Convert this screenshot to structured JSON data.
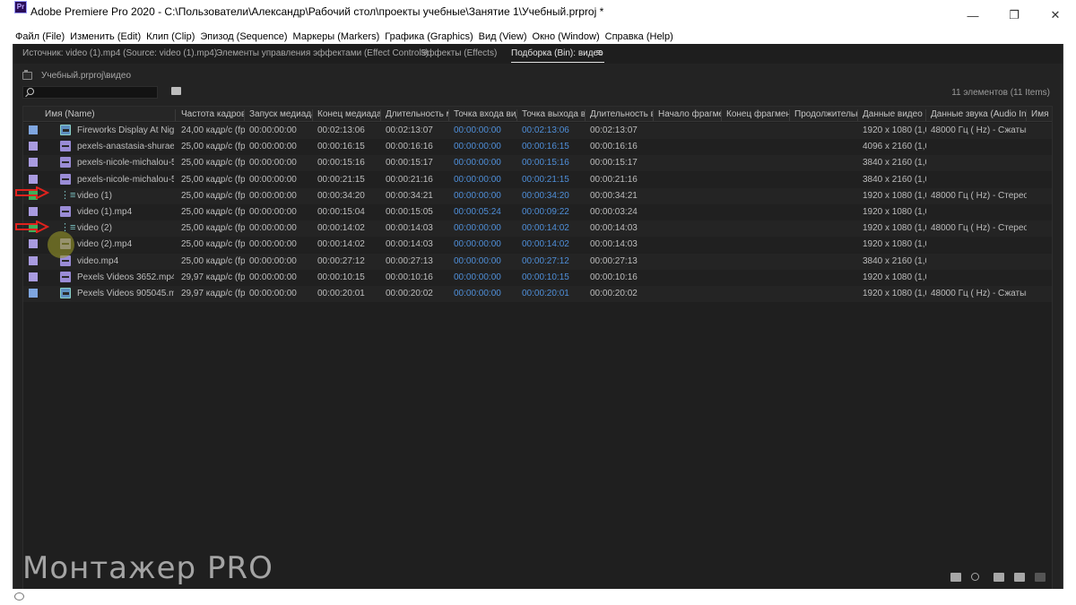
{
  "window": {
    "app_icon": "Pr",
    "title": "Adobe Premiere Pro 2020 - C:\\Пользователи\\Александр\\Рабочий стол\\проекты учебные\\Занятие 1\\Учебный.prproj *",
    "minimize": "—",
    "restore": "❐",
    "close": "✕"
  },
  "menu": [
    "Файл (File)",
    "Изменить (Edit)",
    "Клип (Clip)",
    "Эпизод (Sequence)",
    "Маркеры (Markers)",
    "Графика (Graphics)",
    "Вид (View)",
    "Окно (Window)",
    "Справка (Help)"
  ],
  "panel_tabs": [
    {
      "label": "Источник: video (1).mp4 (Source: video (1).mp4)"
    },
    {
      "label": "Элементы управления эффектами (Effect Controls)"
    },
    {
      "label": "Эффекты (Effects)"
    },
    {
      "label": "Подборка (Bin): видео"
    }
  ],
  "panel_menu_icon": "≡",
  "bin": {
    "path": "Учебный.prproj\\видео",
    "search_placeholder": "",
    "item_count": "11 элементов (11 Items)"
  },
  "columns": [
    "Имя (Name)",
    "Частота кадров (F",
    "Запуск медиадан",
    "Конец медиаданн",
    "Длительность ме",
    "Точка входа виде",
    "Точка выхода вид",
    "Длительность ви",
    "Начало фрагмент",
    "Конец фрагмента",
    "Продолжительнос",
    "Данные видео (Vi",
    "Данные звука (Audio Info)",
    "Имя"
  ],
  "rows": [
    {
      "name": "Fireworks Display At Night.",
      "type": "av",
      "color": "#7fa6e0",
      "fps": "24,00 кадр/с (fps)",
      "start": "00:00:00:00",
      "end": "00:02:13:06",
      "dur": "00:02:13:07",
      "in": "00:00:00:00",
      "out": "00:02:13:06",
      "vdur": "00:02:13:07",
      "video": "1920 x 1080 (1,0)",
      "audio": "48000 Гц ( Hz) - Сжатый (С"
    },
    {
      "name": "pexels-anastasia-shuraeva-",
      "type": "vid",
      "color": "#a99be0",
      "fps": "25,00 кадр/с (fps)",
      "start": "00:00:00:00",
      "end": "00:00:16:15",
      "dur": "00:00:16:16",
      "in": "00:00:00:00",
      "out": "00:00:16:15",
      "vdur": "00:00:16:16",
      "video": "4096 x 2160 (1,0)",
      "audio": ""
    },
    {
      "name": "pexels-nicole-michalou-573",
      "type": "vid",
      "color": "#a99be0",
      "fps": "25,00 кадр/с (fps)",
      "start": "00:00:00:00",
      "end": "00:00:15:16",
      "dur": "00:00:15:17",
      "in": "00:00:00:00",
      "out": "00:00:15:16",
      "vdur": "00:00:15:17",
      "video": "3840 x 2160 (1,0)",
      "audio": ""
    },
    {
      "name": "pexels-nicole-michalou-573",
      "type": "vid",
      "color": "#a99be0",
      "fps": "25,00 кадр/с (fps)",
      "start": "00:00:00:00",
      "end": "00:00:21:15",
      "dur": "00:00:21:16",
      "in": "00:00:00:00",
      "out": "00:00:21:15",
      "vdur": "00:00:21:16",
      "video": "3840 x 2160 (1,0)",
      "audio": ""
    },
    {
      "name": "video (1)",
      "type": "seq",
      "color": "#3fae59",
      "fps": "25,00 кадр/с (fps)",
      "start": "00:00:00:00",
      "end": "00:00:34:20",
      "dur": "00:00:34:21",
      "in": "00:00:00:00",
      "out": "00:00:34:20",
      "vdur": "00:00:34:21",
      "video": "1920 x 1080 (1,0)",
      "audio": "48000 Гц ( Hz) - Стерео (St"
    },
    {
      "name": "video (1).mp4",
      "type": "vid",
      "color": "#a99be0",
      "fps": "25,00 кадр/с (fps)",
      "start": "00:00:00:00",
      "end": "00:00:15:04",
      "dur": "00:00:15:05",
      "in": "00:00:05:24",
      "out": "00:00:09:22",
      "vdur": "00:00:03:24",
      "video": "1920 x 1080 (1,0)",
      "audio": ""
    },
    {
      "name": "video (2)",
      "type": "seq",
      "color": "#3fae59",
      "fps": "25,00 кадр/с (fps)",
      "start": "00:00:00:00",
      "end": "00:00:14:02",
      "dur": "00:00:14:03",
      "in": "00:00:00:00",
      "out": "00:00:14:02",
      "vdur": "00:00:14:03",
      "video": "1920 x 1080 (1,0)",
      "audio": "48000 Гц ( Hz) - Стерео (St"
    },
    {
      "name": "video (2).mp4",
      "type": "vid",
      "color": "#a99be0",
      "fps": "25,00 кадр/с (fps)",
      "start": "00:00:00:00",
      "end": "00:00:14:02",
      "dur": "00:00:14:03",
      "in": "00:00:00:00",
      "out": "00:00:14:02",
      "vdur": "00:00:14:03",
      "video": "1920 x 1080 (1,0)",
      "audio": ""
    },
    {
      "name": "video.mp4",
      "type": "vid",
      "color": "#a99be0",
      "fps": "25,00 кадр/с (fps)",
      "start": "00:00:00:00",
      "end": "00:00:27:12",
      "dur": "00:00:27:13",
      "in": "00:00:00:00",
      "out": "00:00:27:12",
      "vdur": "00:00:27:13",
      "video": "3840 x 2160 (1,0)",
      "audio": ""
    },
    {
      "name": "Pexels Videos 3652.mp4",
      "type": "vid",
      "color": "#a99be0",
      "fps": "29,97 кадр/с (fps)",
      "start": "00:00:00:00",
      "end": "00:00:10:15",
      "dur": "00:00:10:16",
      "in": "00:00:00:00",
      "out": "00:00:10:15",
      "vdur": "00:00:10:16",
      "video": "1920 x 1080 (1,0)",
      "audio": ""
    },
    {
      "name": "Pexels Videos 905045.mp4",
      "type": "av",
      "color": "#7fa6e0",
      "fps": "29,97 кадр/с (fps)",
      "start": "00:00:00:00",
      "end": "00:00:20:01",
      "dur": "00:00:20:02",
      "in": "00:00:00:00",
      "out": "00:00:20:01",
      "vdur": "00:00:20:02",
      "video": "1920 x 1080 (1,0)",
      "audio": "48000 Гц ( Hz) - Сжатый (С"
    }
  ],
  "watermark": "Монтажер PRO",
  "colors": {
    "accent_blue": "#4f8fd9",
    "annotation_red": "#e0221d"
  }
}
